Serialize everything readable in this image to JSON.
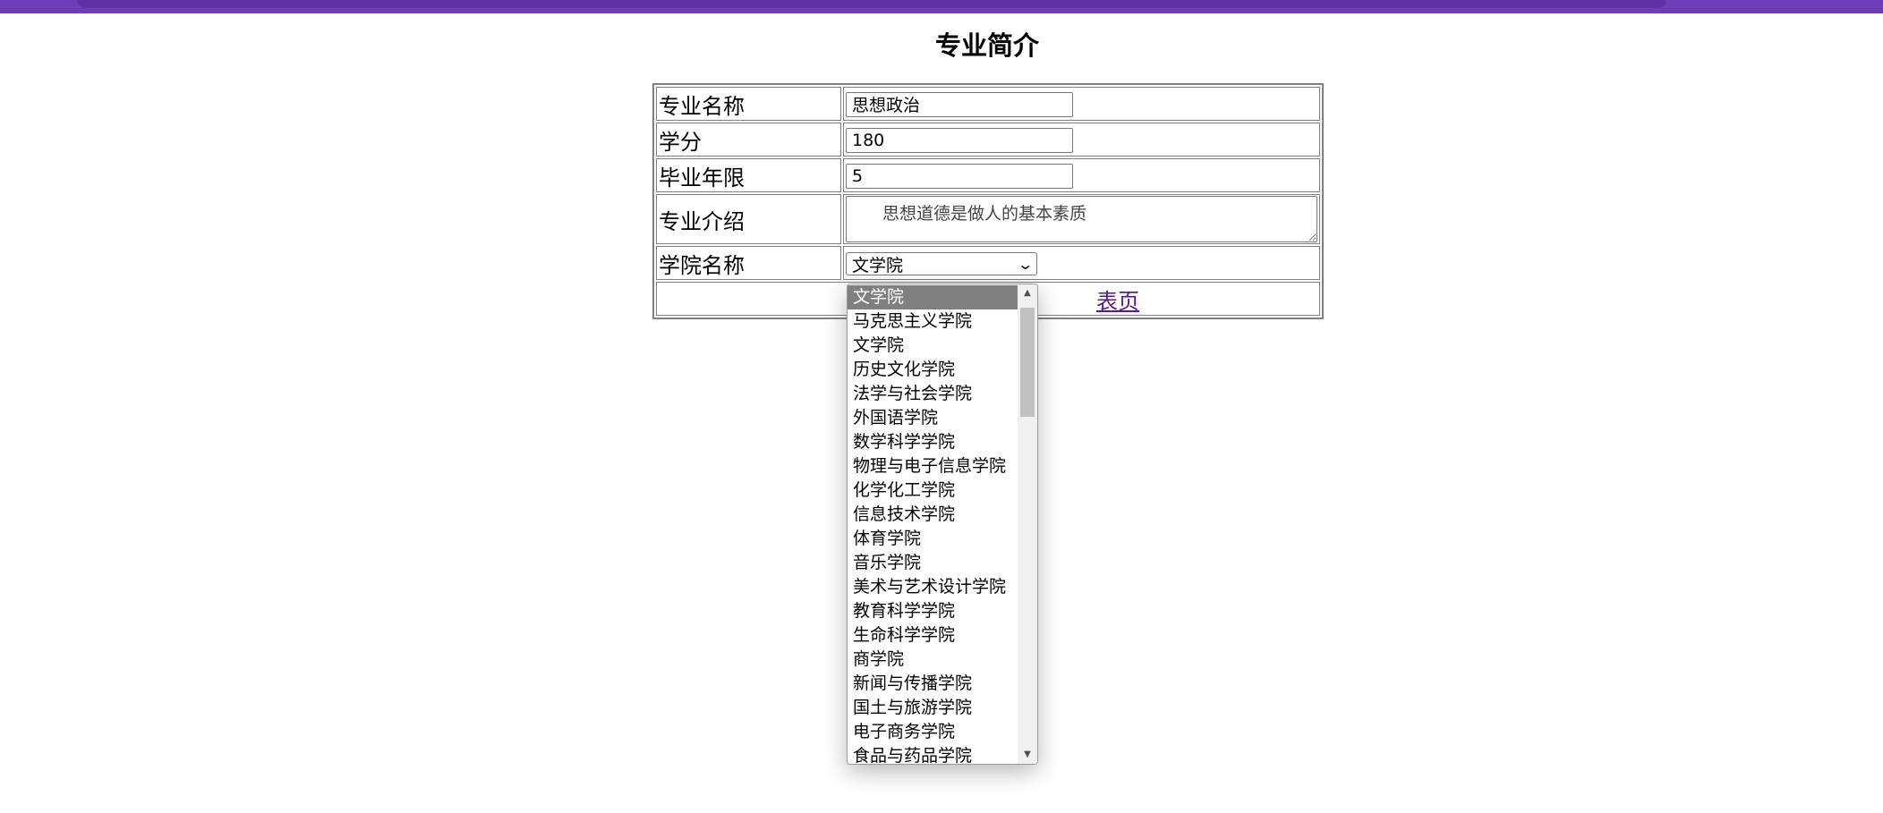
{
  "page": {
    "title": "专业简介"
  },
  "form": {
    "rows": [
      {
        "label": "专业名称",
        "value": "思想政治"
      },
      {
        "label": "学分",
        "value": "180"
      },
      {
        "label": "毕业年限",
        "value": "5"
      },
      {
        "label": "专业介绍",
        "value": "思想道德是做人的基本素质"
      },
      {
        "label": "学院名称",
        "value": "文学院"
      }
    ],
    "link_text": "表页"
  },
  "dropdown": {
    "selected_index": 0,
    "options": [
      "文学院",
      "马克思主义学院",
      "文学院",
      "历史文化学院",
      "法学与社会学院",
      "外国语学院",
      "数学科学学院",
      "物理与电子信息学院",
      "化学化工学院",
      "信息技术学院",
      "体育学院",
      "音乐学院",
      "美术与艺术设计学院",
      "教育科学学院",
      "生命科学学院",
      "商学院",
      "新闻与传播学院",
      "国土与旅游学院",
      "电子商务学院",
      "食品与药品学院"
    ]
  },
  "icons": {
    "select_arrow": "chevron-down-icon",
    "scroll_up": "scroll-up-arrow-icon",
    "scroll_down": "scroll-down-arrow-icon"
  },
  "colors": {
    "header_bar": "#6d3fb6",
    "link": "#551a8b",
    "selected_option": "#808080"
  }
}
